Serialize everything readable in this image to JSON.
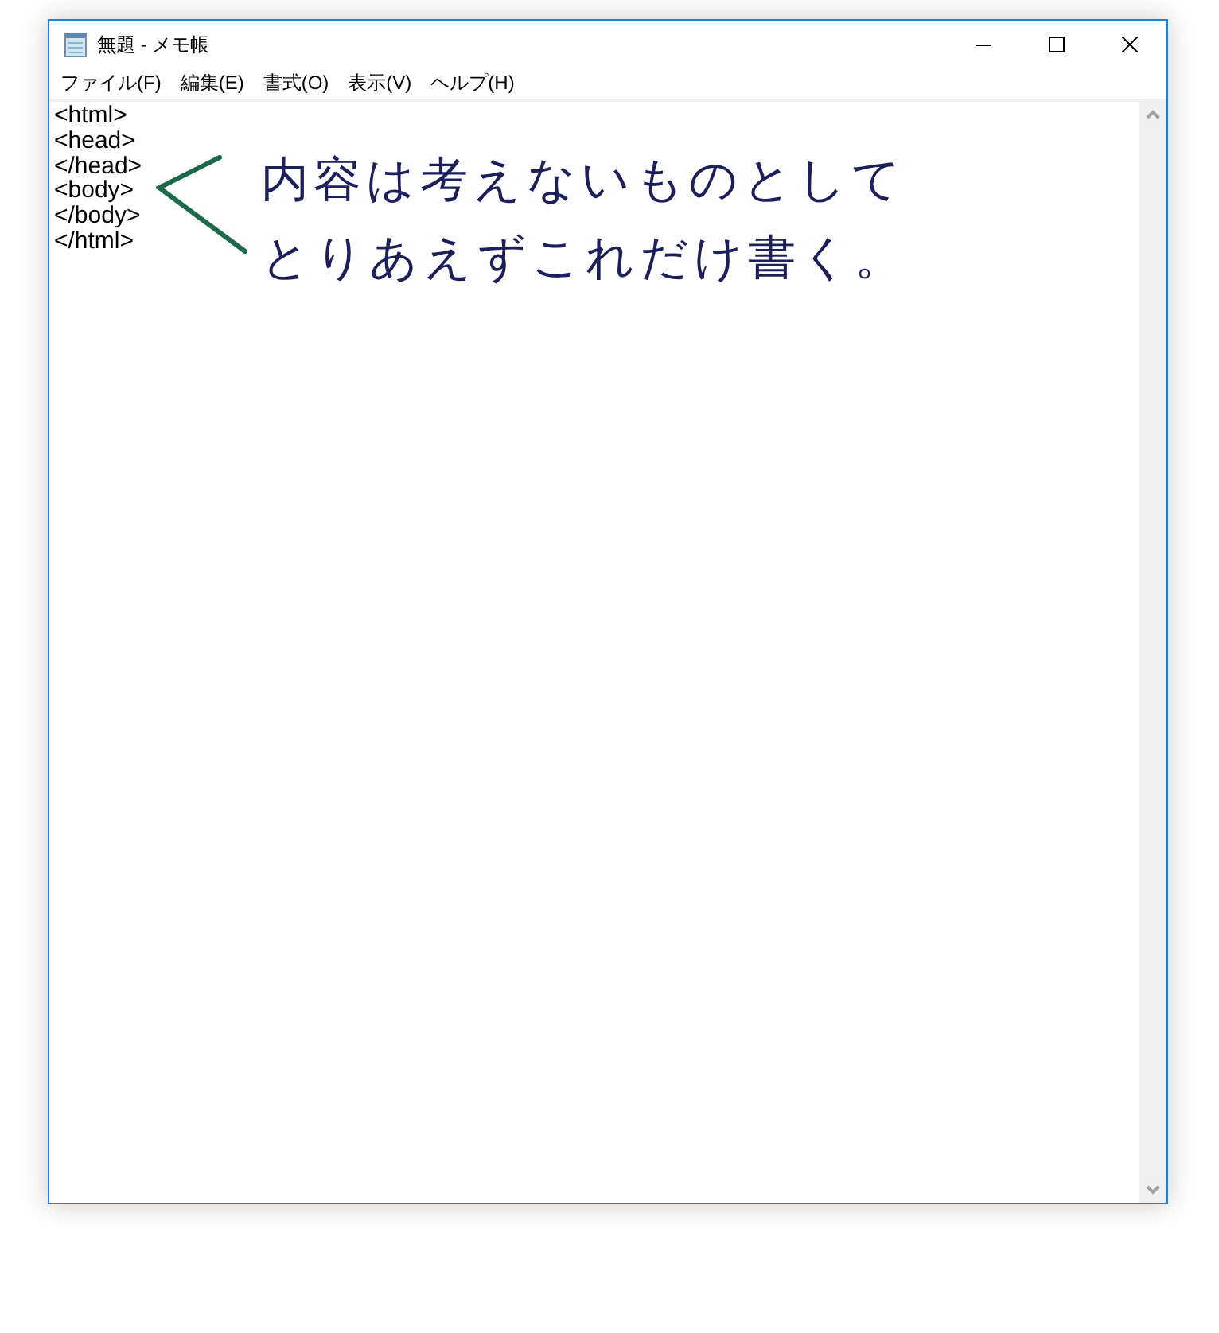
{
  "window": {
    "title": "無題 - メモ帳"
  },
  "menu": [
    "ファイル(F)",
    "編集(E)",
    "書式(O)",
    "表示(V)",
    "ヘルプ(H)"
  ],
  "editor": {
    "lines": [
      "<html>",
      "<head>",
      "</head>",
      "<body>",
      "</body>",
      "</html>"
    ]
  },
  "annotation": {
    "lines": [
      "内容は考えないものとして",
      "とりあえずこれだけ書く。"
    ]
  }
}
